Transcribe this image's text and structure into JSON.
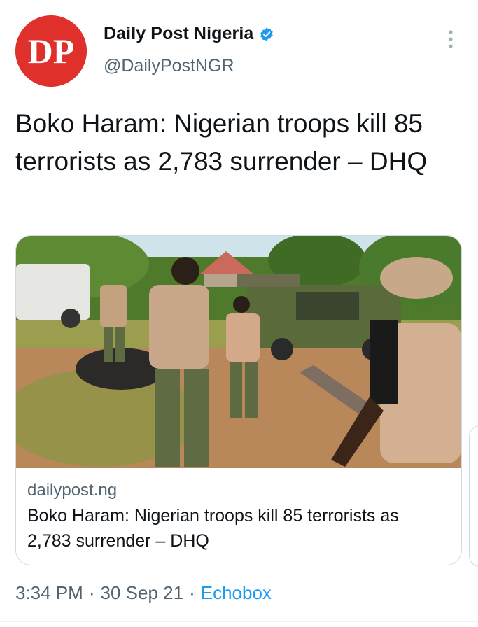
{
  "header": {
    "avatar_text": "DP",
    "display_name": "Daily Post Nigeria",
    "handle": "@DailyPostNGR"
  },
  "tweet": {
    "text": "Boko Haram: Nigerian troops kill 85 terrorists as 2,783 surrender – DHQ"
  },
  "card": {
    "domain": "dailypost.ng",
    "title": "Boko Haram: Nigerian troops kill 85 terrorists as 2,783 surrender – DHQ"
  },
  "meta": {
    "time": "3:34 PM",
    "separator": "·",
    "date": "30 Sep 21",
    "source": "Echobox"
  },
  "colors": {
    "avatar_red": "#e0302b",
    "verified_blue": "#1d9bf0",
    "secondary_text": "#536471",
    "link_blue": "#1d9bf0"
  },
  "icons": {
    "verified": "verified-badge-icon",
    "more": "more-vertical-icon"
  }
}
